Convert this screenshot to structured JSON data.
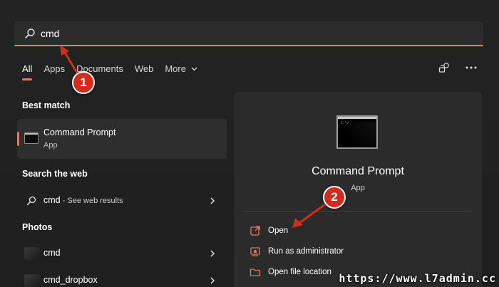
{
  "search": {
    "value": "cmd",
    "placeholder": ""
  },
  "tabs": [
    {
      "label": "All",
      "active": true
    },
    {
      "label": "Apps"
    },
    {
      "label": "Documents"
    },
    {
      "label": "Web"
    },
    {
      "label": "More"
    }
  ],
  "top_right_icons": [
    "share-device-icon",
    "more-options-icon"
  ],
  "best_match": {
    "heading": "Best match",
    "title": "Command Prompt",
    "subtitle": "App"
  },
  "search_web": {
    "heading": "Search the web",
    "query": "cmd",
    "suffix": " - See web results"
  },
  "photos": {
    "heading": "Photos",
    "items": [
      {
        "label": "cmd"
      },
      {
        "label": "cmd_dropbox"
      }
    ]
  },
  "preview": {
    "title": "Command Prompt",
    "subtitle": "App",
    "actions": [
      {
        "label": "Open",
        "icon": "open-external-icon"
      },
      {
        "label": "Run as administrator",
        "icon": "shield-admin-icon"
      },
      {
        "label": "Open file location",
        "icon": "folder-icon"
      }
    ]
  },
  "callouts": [
    "1",
    "2"
  ],
  "watermark": "https://www.l7admin.cc",
  "colors": {
    "accent": "#e07a63",
    "callout": "#d52b1e",
    "background": "#202020",
    "panel": "#2b2b2b"
  }
}
